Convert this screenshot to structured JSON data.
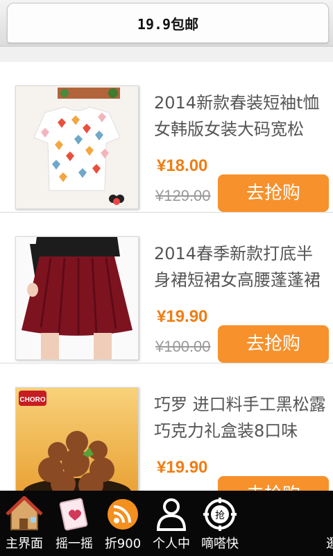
{
  "header": {
    "title": "19.9包邮"
  },
  "products": [
    {
      "title": "2014新款春装短袖t恤女韩版女装大码宽松",
      "price": "¥18.00",
      "old_price": "¥129.00",
      "buy_label": "去抢购",
      "image": "heart-print-tshirt"
    },
    {
      "title": "2014春季新款打底半身裙短裙女高腰蓬蓬裙",
      "price": "¥19.90",
      "old_price": "¥100.00",
      "buy_label": "去抢购",
      "image": "red-pleated-skirt"
    },
    {
      "title": "巧罗 进口料手工黑松露巧克力礼盒装8口味",
      "price": "¥19.90",
      "old_price": "",
      "buy_label": "去抢购",
      "image": "truffle-chocolate",
      "logo_text": "CHORO"
    }
  ],
  "tabbar": {
    "items": [
      {
        "label": "主界面",
        "icon": "home-icon"
      },
      {
        "label": "摇一摇",
        "icon": "shake-card-icon"
      },
      {
        "label": "折900",
        "icon": "rss-icon"
      },
      {
        "label": "个人中",
        "icon": "person-icon"
      },
      {
        "label": "嘀嗒快",
        "icon": "grab-icon"
      },
      {
        "label": "逛",
        "icon": "more-icon"
      }
    ]
  }
}
